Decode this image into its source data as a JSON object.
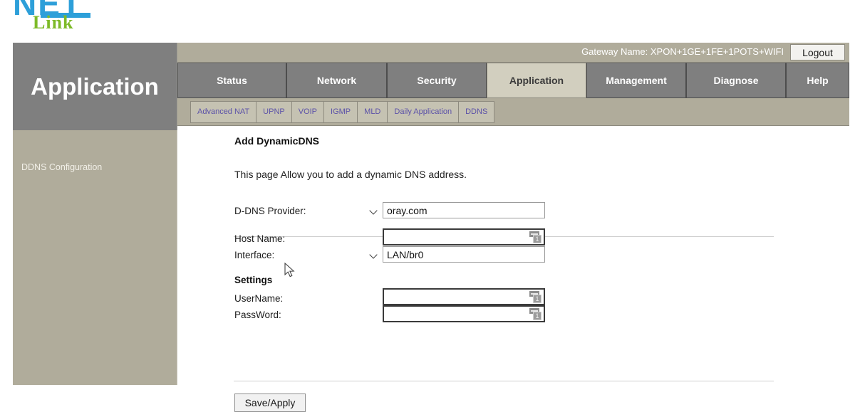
{
  "logo": {
    "primary_text": "NET",
    "secondary_text": "Link",
    "primary_color": "#2d9fd9",
    "secondary_color": "#7dba28"
  },
  "header": {
    "gateway_label": "Gateway Name: XPON+1GE+1FE+1POTS+WIFI",
    "logout_label": "Logout"
  },
  "section_title": "Application",
  "tabs": [
    {
      "label": "Status",
      "active": false
    },
    {
      "label": "Network",
      "active": false
    },
    {
      "label": "Security",
      "active": false
    },
    {
      "label": "Application",
      "active": true
    },
    {
      "label": "Management",
      "active": false
    },
    {
      "label": "Diagnose",
      "active": false
    },
    {
      "label": "Help",
      "active": false
    }
  ],
  "subtabs": [
    {
      "label": "Advanced NAT"
    },
    {
      "label": "UPNP"
    },
    {
      "label": "VOIP"
    },
    {
      "label": "IGMP"
    },
    {
      "label": "MLD"
    },
    {
      "label": "Daily Application"
    },
    {
      "label": "DDNS"
    }
  ],
  "sidebar": {
    "items": [
      {
        "label": "DDNS Configuration"
      }
    ]
  },
  "main": {
    "heading": "Add DynamicDNS",
    "description": "This page Allow you to add a dynamic DNS address.",
    "fields": {
      "provider_label": "D-DNS Provider:",
      "provider_value": "oray.com",
      "provider_options": [
        "oray.com"
      ],
      "hostname_label": "Host Name:",
      "hostname_value": "",
      "hostname_placeholder": "",
      "interface_label": "Interface:",
      "interface_value": "LAN/br0",
      "interface_options": [
        "LAN/br0"
      ],
      "settings_label": "Settings",
      "username_label": "UserName:",
      "username_value": "",
      "username_placeholder": "",
      "password_label": "PassWord:",
      "password_value": "",
      "password_placeholder": ""
    },
    "save_label": "Save/Apply"
  },
  "theme": {
    "tan": "#b0ac9b",
    "tan_light": "#c5c2b2",
    "tab_gray": "#7f7f7f",
    "tab_active": "#d2cfbf",
    "subtab_text": "#5b51a8"
  }
}
